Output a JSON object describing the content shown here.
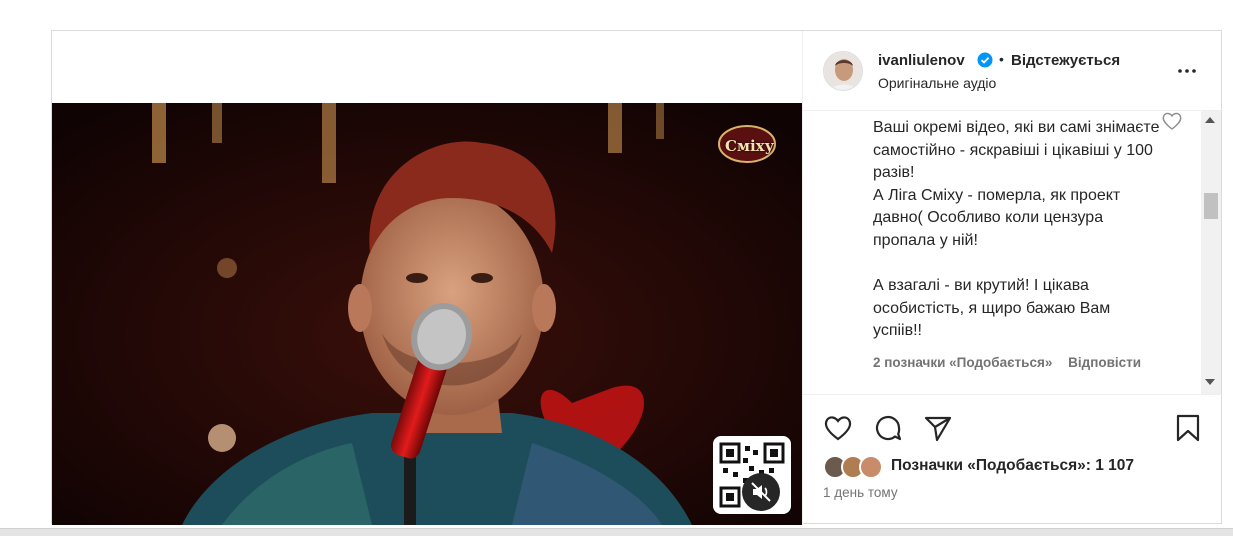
{
  "header": {
    "username": "ivanliulenov",
    "separator": "•",
    "follow_status": "Відстежується",
    "audio_label": "Оригінальне аудіо"
  },
  "comment": {
    "text": "Ваші окремі відео, які ви самі знімаєте самостійно - яскравіші і цікавіші у 100 разів!\nА Ліга Сміху - померла, як проект давно( Особливо коли цензура пропала у ній!\n\nА взагалі - ви крутий! І цікава особистість, я щиро бажаю Вам успіів!!",
    "likes_label": "2 позначки «Подобається»",
    "reply_label": "Відповісти"
  },
  "actions": {
    "likes_text": "Позначки «Подобається»: 1 107",
    "time_ago": "1 день тому"
  },
  "video": {
    "show_logo_text": "Сміху",
    "muted": true
  },
  "colors": {
    "verified": "#0095f6",
    "text": "#262626",
    "secondary_text": "#737373",
    "border": "#dbdbdb"
  },
  "icons": {
    "more": "more-horizontal-icon",
    "like": "heart-outline-icon",
    "comment": "speech-bubble-icon",
    "share": "paper-plane-icon",
    "save": "bookmark-outline-icon",
    "mute": "speaker-muted-icon",
    "verified": "verified-badge-icon"
  }
}
